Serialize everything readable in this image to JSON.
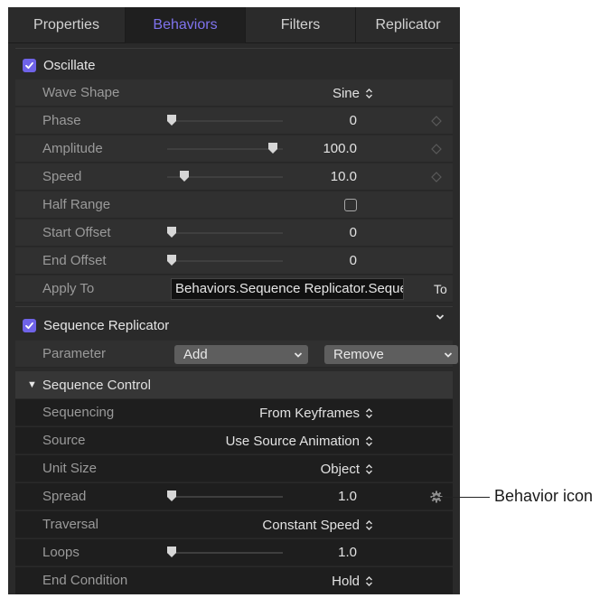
{
  "tabs": [
    {
      "label": "Properties",
      "active": false
    },
    {
      "label": "Behaviors",
      "active": true
    },
    {
      "label": "Filters",
      "active": false
    },
    {
      "label": "Replicator",
      "active": false
    }
  ],
  "oscillate": {
    "title": "Oscillate",
    "checked": true,
    "wave_shape": {
      "label": "Wave Shape",
      "value": "Sine"
    },
    "phase": {
      "label": "Phase",
      "value": "0",
      "slider_fraction": 0.0
    },
    "amplitude": {
      "label": "Amplitude",
      "value": "100.0",
      "slider_fraction": 0.95
    },
    "speed": {
      "label": "Speed",
      "value": "10.0",
      "slider_fraction": 0.12
    },
    "half_range": {
      "label": "Half Range",
      "checked": false
    },
    "start_offset": {
      "label": "Start Offset",
      "value": "0",
      "slider_fraction": 0.0
    },
    "end_offset": {
      "label": "End Offset",
      "value": "0",
      "slider_fraction": 0.0
    },
    "apply_to": {
      "label": "Apply To",
      "value": "Behaviors.Sequence Replicator.Sequence Control.Spread",
      "menu": "To"
    }
  },
  "sequence_replicator": {
    "title": "Sequence Replicator",
    "checked": true,
    "parameter": {
      "label": "Parameter",
      "add": "Add",
      "remove": "Remove"
    },
    "sequence_control": {
      "title": "Sequence Control",
      "sequencing": {
        "label": "Sequencing",
        "value": "From Keyframes"
      },
      "source": {
        "label": "Source",
        "value": "Use Source Animation"
      },
      "unit_size": {
        "label": "Unit Size",
        "value": "Object"
      },
      "spread": {
        "label": "Spread",
        "value": "1.0",
        "slider_fraction": 0.0
      },
      "traversal": {
        "label": "Traversal",
        "value": "Constant Speed"
      },
      "loops": {
        "label": "Loops",
        "value": "1.0",
        "slider_fraction": 0.0
      },
      "end_condition": {
        "label": "End Condition",
        "value": "Hold"
      }
    }
  },
  "callout": {
    "label": "Behavior icon"
  },
  "colors": {
    "accent": "#7f73ee",
    "checkbox": "#6f63e8",
    "panel": "#2a2a2a"
  }
}
